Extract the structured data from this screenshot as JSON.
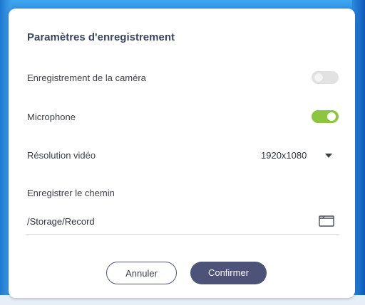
{
  "dialog": {
    "title": "Paramètres d'enregistrement"
  },
  "settings": {
    "camera": {
      "label": "Enregistrement de la caméra",
      "enabled": false
    },
    "microphone": {
      "label": "Microphone",
      "enabled": true
    },
    "resolution": {
      "label": "Résolution vidéo",
      "value": "1920x1080"
    },
    "path": {
      "label": "Enregistrer le chemin",
      "value": "/Storage/Record"
    }
  },
  "buttons": {
    "cancel": "Annuler",
    "confirm": "Confirmer"
  },
  "icons": {
    "dropdown": "chevron-down-icon",
    "folder": "folder-icon"
  },
  "colors": {
    "toggle_on": "#8cc63f",
    "toggle_off": "#e2e2e2",
    "primary_button": "#4c5278",
    "title_text": "#3a4560"
  }
}
